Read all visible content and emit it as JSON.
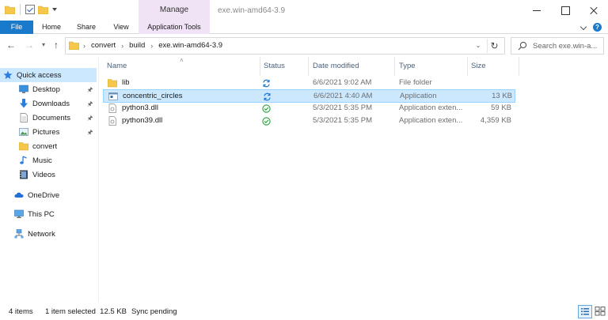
{
  "window": {
    "title": "exe.win-amd64-3.9",
    "context_tab": "Manage"
  },
  "ribbon": {
    "tabs": [
      {
        "label": "File"
      },
      {
        "label": "Home"
      },
      {
        "label": "Share"
      },
      {
        "label": "View"
      },
      {
        "label": "Application Tools"
      }
    ]
  },
  "address": {
    "crumbs": [
      "convert",
      "build",
      "exe.win-amd64-3.9"
    ],
    "search_placeholder": "Search exe.win-a..."
  },
  "nav": {
    "items": [
      {
        "label": "Quick access",
        "icon": "star-icon"
      },
      {
        "label": "Desktop",
        "icon": "desktop-icon",
        "pinned": true
      },
      {
        "label": "Downloads",
        "icon": "download-arrow-icon",
        "pinned": true
      },
      {
        "label": "Documents",
        "icon": "document-icon",
        "pinned": true
      },
      {
        "label": "Pictures",
        "icon": "picture-icon",
        "pinned": true
      },
      {
        "label": "convert",
        "icon": "folder-icon"
      },
      {
        "label": "Music",
        "icon": "music-note-icon"
      },
      {
        "label": "Videos",
        "icon": "film-icon"
      },
      {
        "label": "OneDrive",
        "icon": "cloud-icon"
      },
      {
        "label": "This PC",
        "icon": "monitor-icon"
      },
      {
        "label": "Network",
        "icon": "network-icon"
      }
    ]
  },
  "columns": {
    "name": "Name",
    "status": "Status",
    "date": "Date modified",
    "type": "Type",
    "size": "Size"
  },
  "files": [
    {
      "name": "lib",
      "date": "6/6/2021 9:02 AM",
      "type": "File folder",
      "size": "",
      "status_icon": "sync-icon",
      "icon": "folder-icon"
    },
    {
      "name": "concentric_circles",
      "date": "6/6/2021 4:40 AM",
      "type": "Application",
      "size": "13 KB",
      "status_icon": "sync-icon",
      "icon": "application-icon"
    },
    {
      "name": "python3.dll",
      "date": "5/3/2021 5:35 PM",
      "type": "Application exten...",
      "size": "59 KB",
      "status_icon": "synced-check-icon",
      "icon": "dll-file-icon"
    },
    {
      "name": "python39.dll",
      "date": "5/3/2021 5:35 PM",
      "type": "Application exten...",
      "size": "4,359 KB",
      "status_icon": "synced-check-icon",
      "icon": "dll-file-icon"
    }
  ],
  "status": {
    "count": "4 items",
    "selected": "1 item selected  12.5 KB",
    "sync": "Sync pending"
  },
  "colors": {
    "accent": "#1979ca",
    "selection": "#cce8ff",
    "context_tab": "#efe3f5"
  }
}
